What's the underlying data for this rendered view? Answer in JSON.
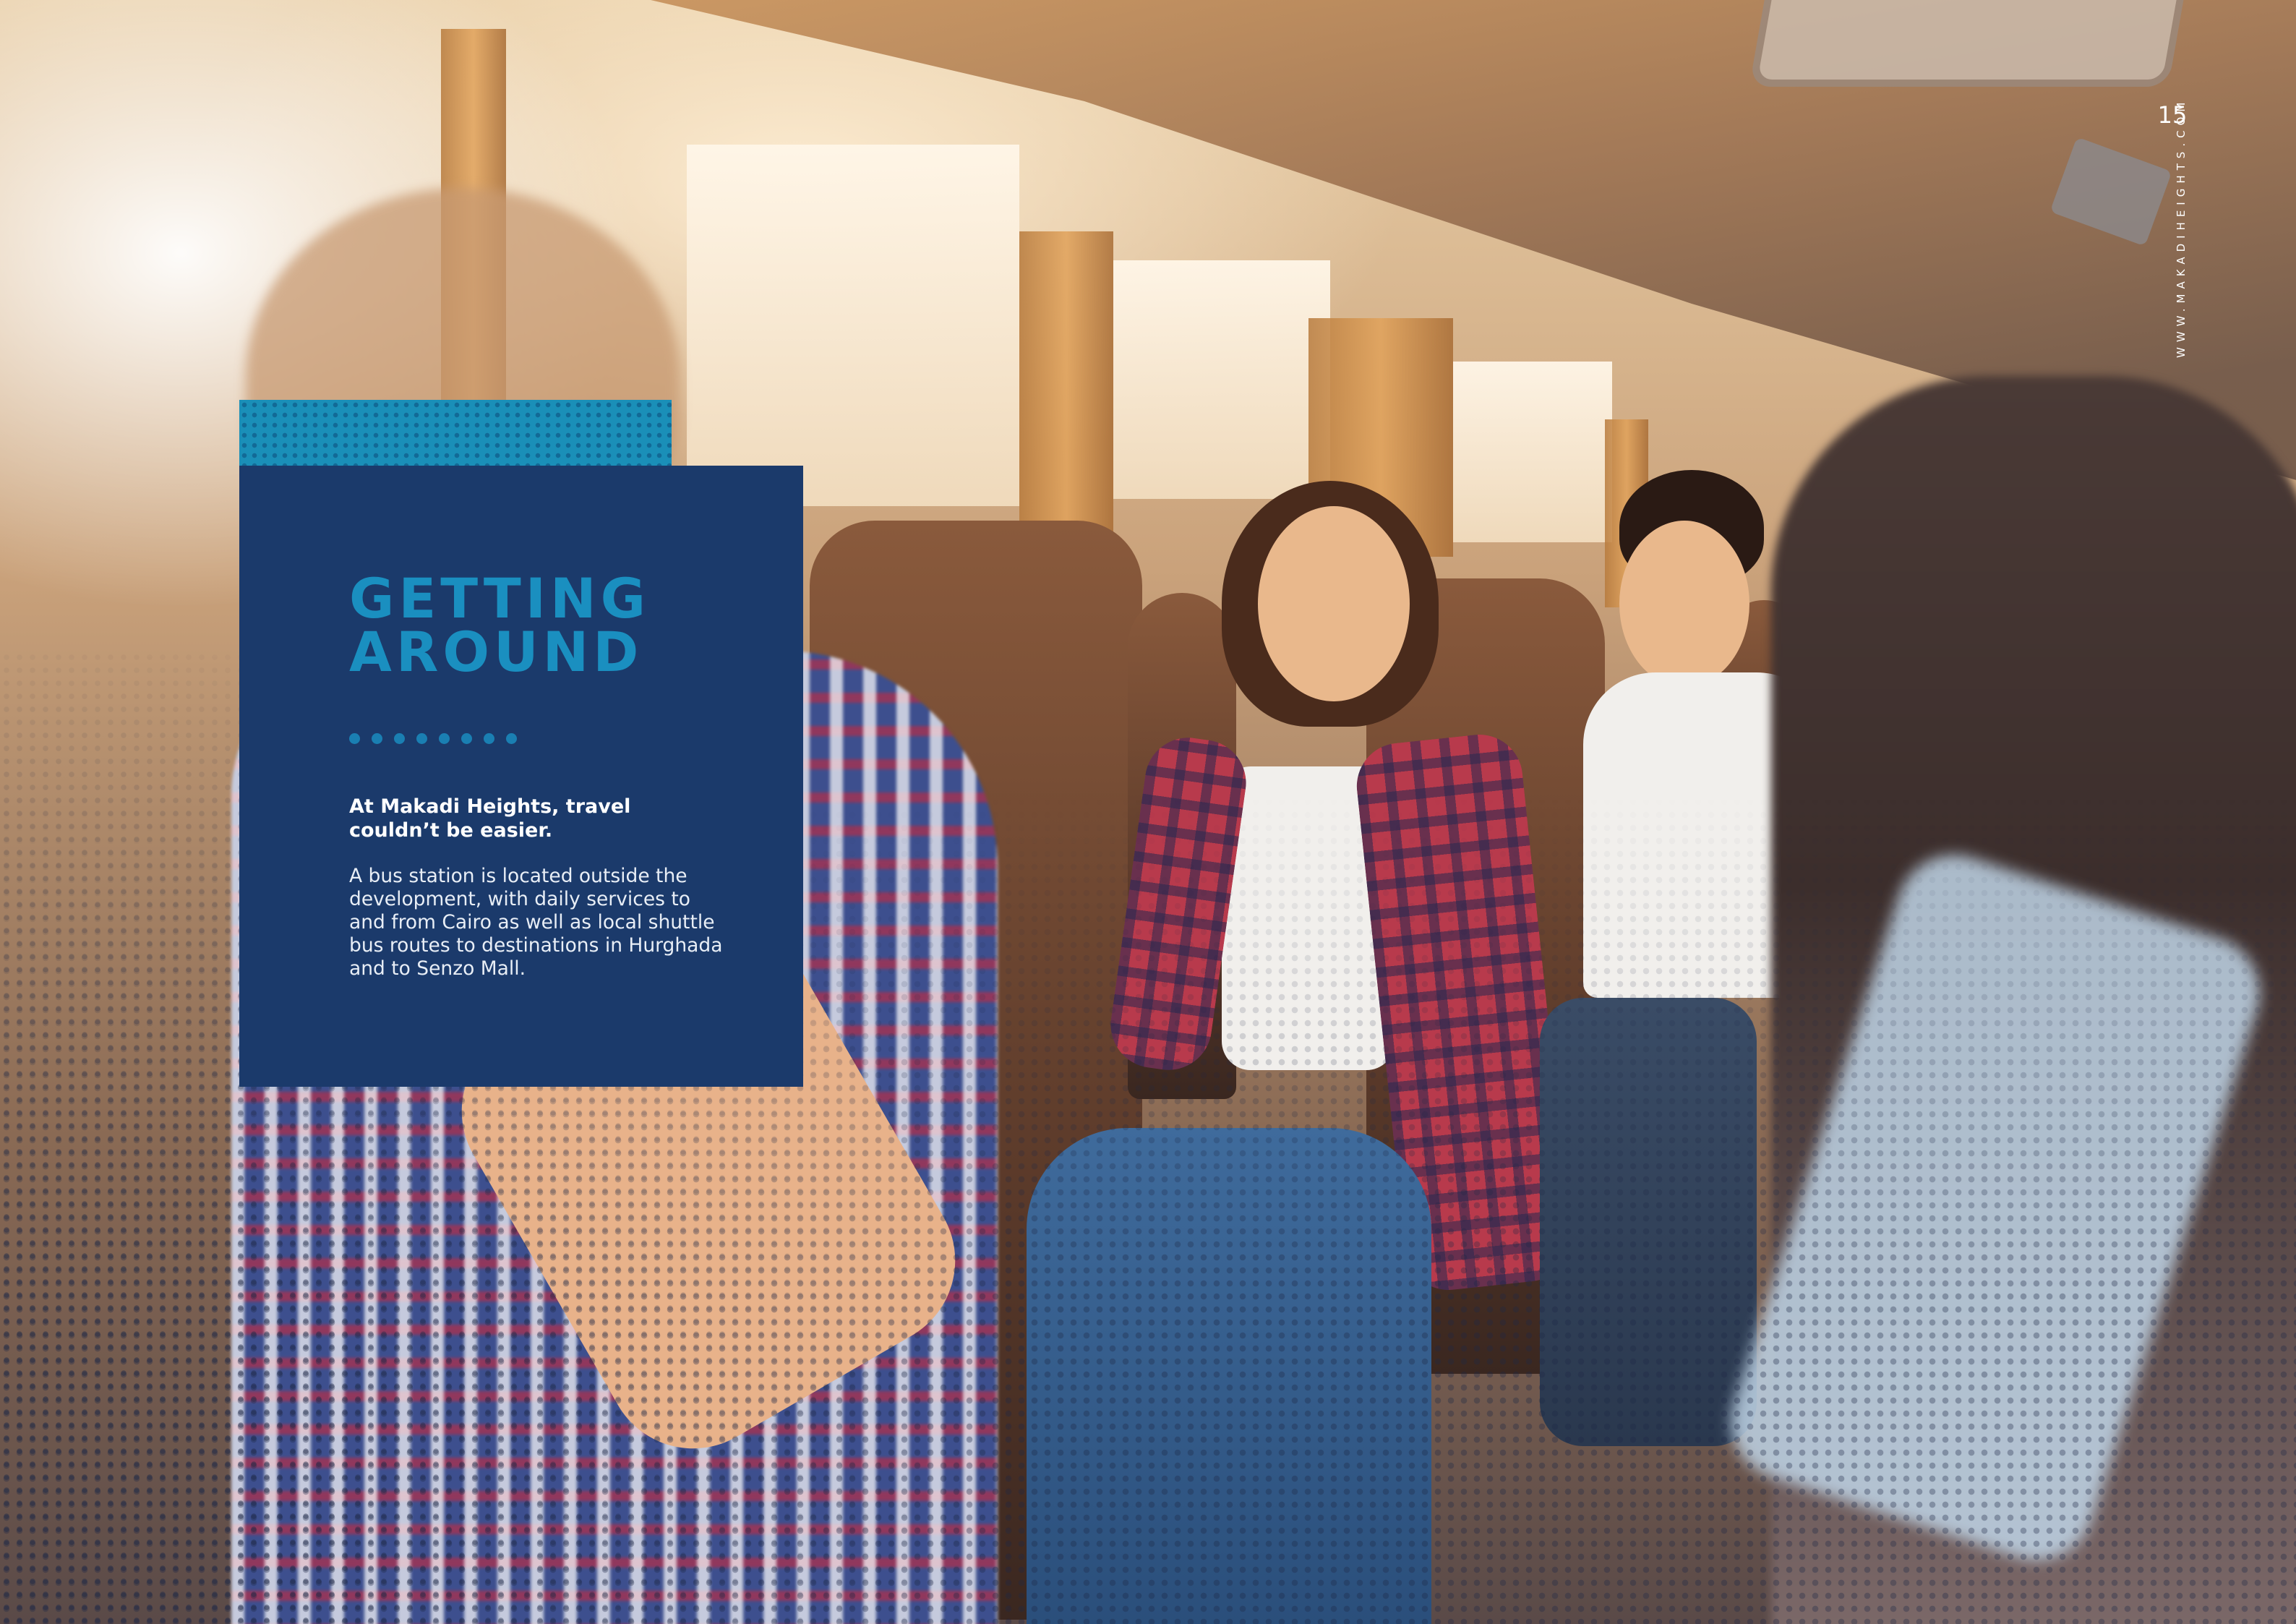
{
  "page": {
    "number": "15",
    "website": "WWW.MAKADIHEIGHTS.COM"
  },
  "card": {
    "title": "GETTING\nAROUND",
    "lead": "At Makadi Heights, travel couldn’t be easier.",
    "body": "A bus station is located outside the development, with daily services to and from Cairo as well as local shuttle bus routes to destinations in Hurghada and to Senzo Mall.",
    "dot_count": 8
  },
  "colors": {
    "card_background": "#1b3a6b",
    "card_accent": "#1a8fb8",
    "title": "#1a8fc0",
    "dots": "#1a7fb2"
  },
  "photo": {
    "subject": "bus-interior-photo"
  }
}
